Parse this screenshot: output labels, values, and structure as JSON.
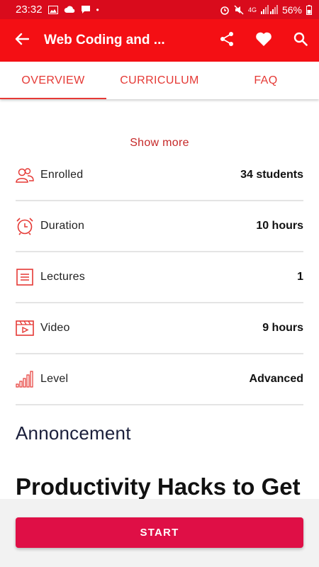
{
  "status_bar": {
    "time": "23:32",
    "dot": "•",
    "network": "4G",
    "battery": "56%"
  },
  "app_bar": {
    "title": "Web Coding and ...",
    "icons": [
      "arrow-left-icon",
      "share-icon",
      "heart-icon",
      "search-icon"
    ]
  },
  "tabs": [
    {
      "label": "OVERVIEW",
      "active": true
    },
    {
      "label": "CURRICULUM",
      "active": false
    },
    {
      "label": "FAQ",
      "active": false
    }
  ],
  "overview": {
    "show_more": "Show more",
    "info": [
      {
        "icon": "users-icon",
        "label": "Enrolled",
        "value": "34 students"
      },
      {
        "icon": "alarm-clock-icon",
        "label": "Duration",
        "value": "10 hours"
      },
      {
        "icon": "list-icon",
        "label": "Lectures",
        "value": "1"
      },
      {
        "icon": "video-icon",
        "label": "Video",
        "value": "9 hours"
      },
      {
        "icon": "signal-bars-icon",
        "label": "Level",
        "value": "Advanced"
      }
    ],
    "announcement_heading": "Annoncement",
    "article_title": "Productivity Hacks to Get"
  },
  "start_button": "START",
  "colors": {
    "primary": "#f40f14",
    "status_bar": "#d90b1c",
    "accent": "#e53935",
    "start": "#df0f46"
  }
}
